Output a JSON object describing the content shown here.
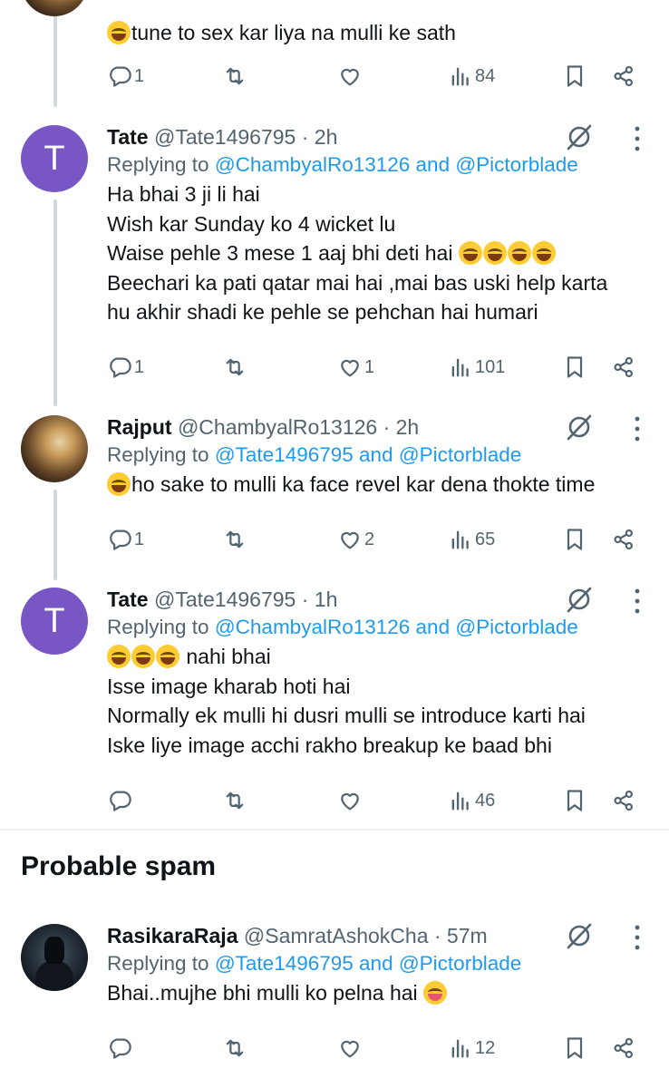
{
  "tweets": [
    {
      "text_lines": [
        "tune to sex kar liya na mulli ke sath"
      ],
      "emoji_prefix": "rofl",
      "stats": {
        "replies": "1",
        "retweets": "",
        "likes": "",
        "views": "84"
      }
    },
    {
      "avatar_letter": "T",
      "name": "Tate",
      "meta": "@Tate1496795 · 2h",
      "replying_prefix": "Replying to ",
      "replying_users": "@ChambyalRo13126 and @Pictorblade",
      "text_lines": [
        "Ha bhai 3 ji li hai",
        "Wish kar Sunday ko 4 wicket lu",
        "Waise pehle 3 mese 1 aaj bhi deti hai",
        "Beechari ka pati qatar mai hai ,mai bas uski help karta",
        "hu akhir shadi ke pehle se pehchan hai humari"
      ],
      "stats": {
        "replies": "1",
        "retweets": "",
        "likes": "1",
        "views": "101"
      }
    },
    {
      "name": "Rajput",
      "meta": "@ChambyalRo13126 · 2h",
      "replying_prefix": "Replying to ",
      "replying_users": "@Tate1496795 and @Pictorblade",
      "text_lines": [
        "ho sake to mulli ka face revel kar dena thokte time"
      ],
      "stats": {
        "replies": "1",
        "retweets": "",
        "likes": "2",
        "views": "65"
      }
    },
    {
      "avatar_letter": "T",
      "name": "Tate",
      "meta": "@Tate1496795 · 1h",
      "replying_prefix": "Replying to ",
      "replying_users": "@ChambyalRo13126 and @Pictorblade",
      "text_lines": [
        " nahi bhai",
        "Isse image kharab hoti hai",
        "Normally ek mulli hi dusri mulli se introduce karti hai",
        "Iske liye image acchi rakho breakup ke baad bhi"
      ],
      "stats": {
        "replies": "",
        "retweets": "",
        "likes": "",
        "views": "46"
      }
    },
    {
      "name": "RasikaraRaja",
      "meta": "@SamratAshokCha · 57m",
      "replying_prefix": "Replying to ",
      "replying_users": "@Tate1496795 and @Pictorblade",
      "text_lines": [
        "Bhai..mujhe bhi mulli ko pelna hai "
      ],
      "stats": {
        "replies": "",
        "retweets": "",
        "likes": "",
        "views": "12"
      }
    }
  ],
  "section": {
    "title": "Probable spam"
  },
  "colors": {
    "text": "#0f1419",
    "muted": "#536471",
    "link": "#1d9bf0",
    "avatar": "#7856c4",
    "line": "#cfd9de"
  },
  "icons": [
    "reply-icon",
    "retweet-icon",
    "like-icon",
    "views-icon",
    "bookmark-icon",
    "share-icon",
    "grok-icon",
    "more-icon"
  ]
}
